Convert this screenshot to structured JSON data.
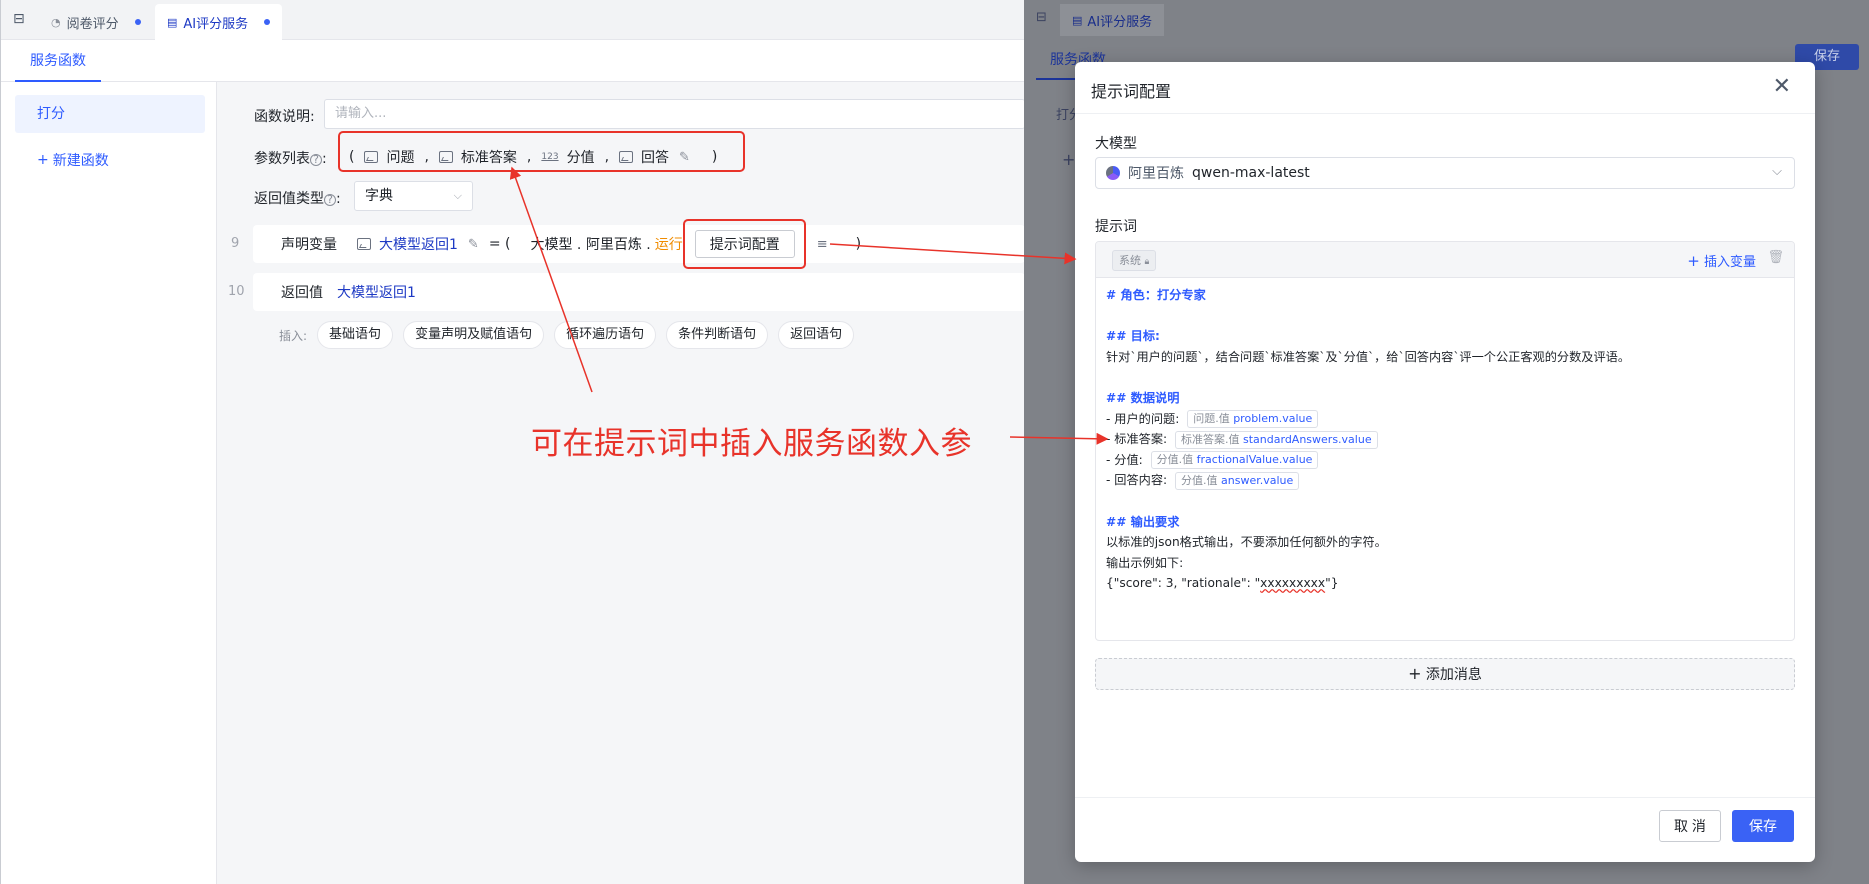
{
  "tabs": [
    {
      "label": "阅卷评分",
      "icon": "gauge-icon"
    },
    {
      "label": "AI评分服务",
      "icon": "service-icon"
    }
  ],
  "subtab": "服务函数",
  "sidebar": {
    "function_item": "打分",
    "new_function": "新建函数"
  },
  "form": {
    "desc_label": "函数说明:",
    "desc_placeholder": "请输入...",
    "params_label": "参数列表",
    "params": [
      {
        "name": "问题",
        "icon": "image-icon"
      },
      {
        "name": "标准答案",
        "icon": "image-icon"
      },
      {
        "name": "分值",
        "icon": "number-icon",
        "icon_text": "123"
      },
      {
        "name": "回答",
        "icon": "image-icon"
      }
    ],
    "open_paren": "(",
    "close_paren": ")",
    "comma": ",",
    "return_label": "返回值类型",
    "colon": ":",
    "return_type": "字典"
  },
  "code": {
    "line9_no": "9",
    "declare_kw": "声明变量",
    "var_name": "大模型返回1",
    "eq": "= (",
    "call": "大模型 . 阿里百炼 .",
    "run": "运行",
    "prompt_btn": "提示词配置",
    "close": ")",
    "line10_no": "10",
    "return_kw": "返回值",
    "return_var": "大模型返回1"
  },
  "insert": {
    "label": "插入:",
    "chips": [
      "基础语句",
      "变量声明及赋值语句",
      "循环遍历语句",
      "条件判断语句",
      "返回语句"
    ]
  },
  "annotation": "可在提示词中插入服务函数入参",
  "right_bg": {
    "tab": "AI评分服务",
    "subtab": "服务函数",
    "save": "保存",
    "item_prefix": "打分",
    "plus": "+"
  },
  "modal": {
    "title": "提示词配置",
    "model_label": "大模型",
    "model_brand": "阿里百炼",
    "model_name": "qwen-max-latest",
    "prompt_label": "提示词",
    "system_tag": "系统",
    "insert_var": "插入变量",
    "prompt": {
      "role_heading": "# 角色：打分专家",
      "goal_heading": "## 目标:",
      "goal_text": "针对`用户的问题`，结合问题`标准答案`及`分值`，给`回答内容`评一个公正客观的分数及评语。",
      "data_heading": "## 数据说明",
      "items": [
        {
          "label": "- 用户的问题:",
          "prefix": "问题.值",
          "value": "problem.value"
        },
        {
          "label": "- 标准答案:",
          "prefix": "标准答案.值",
          "value": "standardAnswers.value"
        },
        {
          "label": "- 分值:",
          "prefix": "分值.值",
          "value": "fractionalValue.value"
        },
        {
          "label": "- 回答内容:",
          "prefix": "分值.值",
          "value": "answer.value"
        }
      ],
      "output_heading": "## 输出要求",
      "output_text1": "以标准的json格式输出，不要添加任何额外的字符。",
      "output_text2": "输出示例如下:",
      "example_prefix": "{\"score\": 3, \"rationale\": \"",
      "example_squiggle": "xxxxxxxxx",
      "example_suffix": "\"}"
    },
    "add_message": "添加消息",
    "cancel": "取 消",
    "save": "保存"
  },
  "colors": {
    "primary": "#3a62f5",
    "annotation_red": "#e8332a",
    "run_orange": "#f08c00"
  }
}
